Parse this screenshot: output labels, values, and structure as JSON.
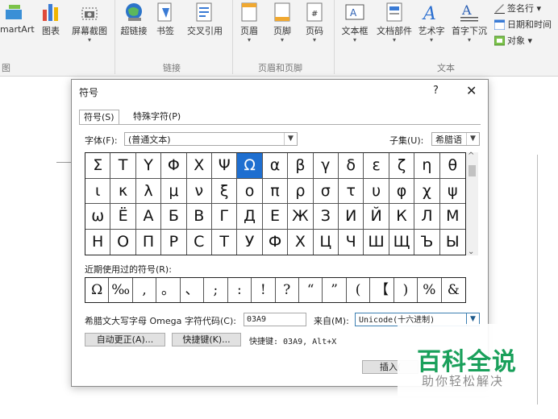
{
  "ribbon": {
    "buttons": [
      {
        "label": "martArt",
        "icon": "smartart-icon"
      },
      {
        "label": "图表",
        "icon": "chart-icon"
      },
      {
        "label": "屏幕截图",
        "icon": "screenshot-icon"
      },
      {
        "label": "超链接",
        "icon": "hyperlink-icon"
      },
      {
        "label": "书签",
        "icon": "bookmark-icon"
      },
      {
        "label": "交叉引用",
        "icon": "cross-reference-icon"
      },
      {
        "label": "页眉",
        "icon": "header-icon"
      },
      {
        "label": "页脚",
        "icon": "footer-icon"
      },
      {
        "label": "页码",
        "icon": "page-number-icon"
      },
      {
        "label": "文本框",
        "icon": "textbox-icon"
      },
      {
        "label": "文档部件",
        "icon": "quick-parts-icon"
      },
      {
        "label": "艺术字",
        "icon": "wordart-icon"
      },
      {
        "label": "首字下沉",
        "icon": "drop-cap-icon"
      }
    ],
    "small_items": [
      "签名行 ▾",
      "日期和时间",
      "对象 ▾"
    ],
    "groups": [
      "图",
      "链接",
      "页眉和页脚",
      "文本"
    ]
  },
  "dialog": {
    "title": "符号",
    "help": "?",
    "close": "✕",
    "tabs": [
      "符号(S)",
      "特殊字符(P)"
    ],
    "font_label": "字体(F):",
    "font_value": "(普通文本)",
    "subset_label": "子集(U):",
    "subset_value": "希腊语",
    "symbols": [
      "Σ",
      "Τ",
      "Υ",
      "Φ",
      "Χ",
      "Ψ",
      "Ω",
      "α",
      "β",
      "γ",
      "δ",
      "ε",
      "ζ",
      "η",
      "θ",
      "ι",
      "κ",
      "λ",
      "μ",
      "ν",
      "ξ",
      "ο",
      "π",
      "ρ",
      "σ",
      "τ",
      "υ",
      "φ",
      "χ",
      "ψ",
      "ω",
      "Ë",
      "А",
      "Б",
      "В",
      "Г",
      "Д",
      "Е",
      "Ж",
      "З",
      "И",
      "Й",
      "К",
      "Л",
      "М",
      "Н",
      "О",
      "П",
      "Р",
      "С",
      "Т",
      "У",
      "Ф",
      "Х",
      "Ц",
      "Ч",
      "Ш",
      "Щ",
      "Ъ",
      "Ы"
    ],
    "selected_index": 6,
    "recent_label": "近期使用过的符号(R):",
    "recent_symbols": [
      "Ω",
      "‰",
      ",",
      "。",
      "、",
      ";",
      ":",
      "!",
      "?",
      "“",
      "”",
      "(",
      "【",
      ")",
      "%",
      "&"
    ],
    "char_name": "希腊文大写字母 Omega",
    "char_code_label": "字符代码(C):",
    "char_code_value": "03A9",
    "from_label": "来自(M):",
    "from_value": "Unicode(十六进制)",
    "autocorrect_label": "自动更正(A)...",
    "shortcut_key_label": "快捷键(K)...",
    "shortcut_text": "快捷键: 03A9, Alt+X",
    "insert_label": "插入("
  },
  "watermark": {
    "title": "百科全说",
    "subtitle": "助你轻松解决"
  },
  "colors": {
    "selected": "#1f6fd0",
    "watermark_green": "#1aa05b"
  }
}
